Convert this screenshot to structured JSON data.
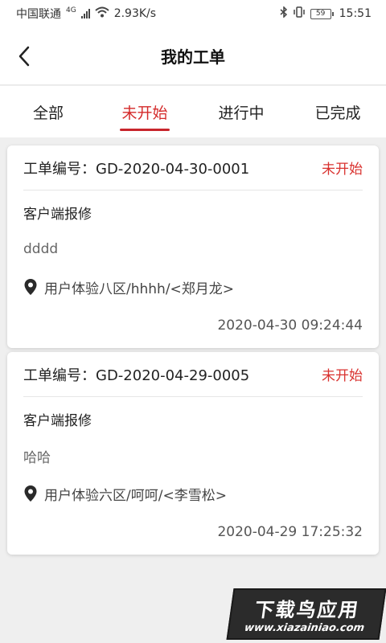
{
  "status_bar": {
    "carrier": "中国联通",
    "network": "4G",
    "speed": "2.93K/s",
    "battery": "59",
    "time": "15:51"
  },
  "header": {
    "title": "我的工单",
    "back_icon": "chevron-left-icon"
  },
  "tabs": [
    {
      "label": "全部",
      "active": false
    },
    {
      "label": "未开始",
      "active": true
    },
    {
      "label": "进行中",
      "active": false
    },
    {
      "label": "已完成",
      "active": false
    }
  ],
  "orders": [
    {
      "number": "工单编号：GD-2020-04-30-0001",
      "status": "未开始",
      "type": "客户端报修",
      "description": "dddd",
      "location": "用户体验八区/hhhh/<郑月龙>",
      "time": "2020-04-30 09:24:44"
    },
    {
      "number": "工单编号：GD-2020-04-29-0005",
      "status": "未开始",
      "type": "客户端报修",
      "description": "哈哈",
      "location": "用户体验六区/呵呵/<李雪松>",
      "time": "2020-04-29 17:25:32"
    }
  ],
  "watermark": {
    "top": "下载鸟应用",
    "bottom": "www.xiazainiao.com"
  },
  "colors": {
    "accent": "#d42a2a",
    "background": "#efefef"
  }
}
